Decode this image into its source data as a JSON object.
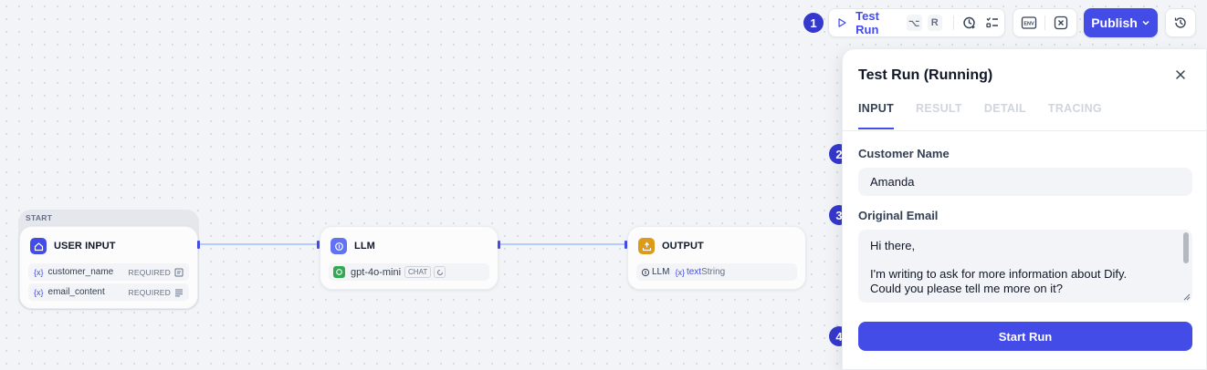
{
  "toolbar": {
    "test_run_label": "Test Run",
    "shortcut_modifier": "⌥",
    "shortcut_key": "R",
    "env_label": "ENV",
    "publish_label": "Publish"
  },
  "steps": [
    "1",
    "2",
    "3",
    "4"
  ],
  "canvas": {
    "start_label": "START",
    "user_input": {
      "title": "USER INPUT",
      "variables": [
        {
          "prefix": "{x}",
          "name": "customer_name",
          "tag": "REQUIRED"
        },
        {
          "prefix": "{x}",
          "name": "email_content",
          "tag": "REQUIRED"
        }
      ]
    },
    "llm": {
      "title": "LLM",
      "model": "gpt-4o-mini",
      "mode": "CHAT"
    },
    "output": {
      "title": "OUTPUT",
      "source": "LLM",
      "var_prefix": "{x}",
      "var_name": "text",
      "var_type": "String"
    }
  },
  "panel": {
    "title": "Test Run (Running)",
    "tabs": [
      "INPUT",
      "RESULT",
      "DETAIL",
      "TRACING"
    ],
    "active_tab": "INPUT",
    "fields": {
      "customer_name_label": "Customer Name",
      "customer_name_value": "Amanda",
      "original_email_label": "Original Email",
      "original_email_lines": [
        "Hi there,",
        "",
        "I'm writing to ask for more information about Dify.",
        "Could you please tell me more on it?"
      ]
    },
    "start_button": "Start Run"
  },
  "colors": {
    "accent": "#444ce7",
    "step_badge": "#3538cd",
    "start_icon": "#444ce7",
    "llm_icon": "#6172f3",
    "output_icon": "#dc9a16",
    "model_icon": "#34a853"
  }
}
